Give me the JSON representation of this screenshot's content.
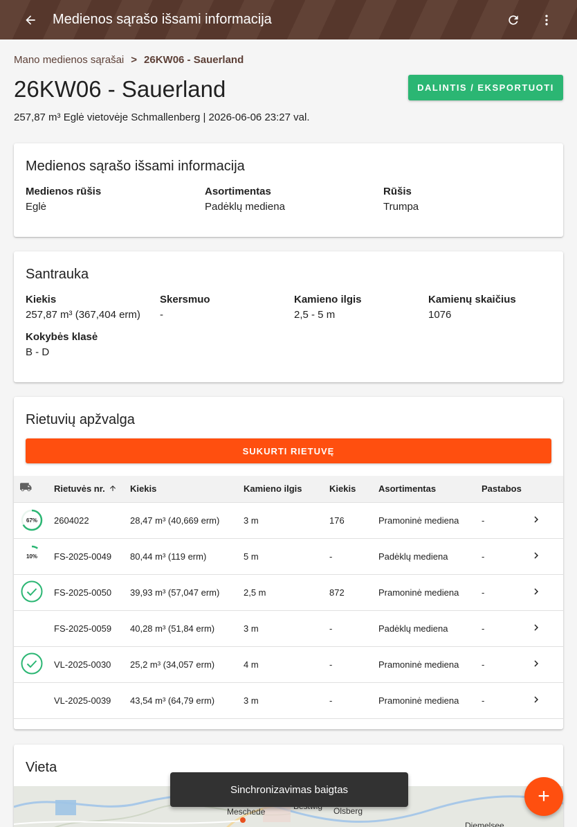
{
  "appbar": {
    "title": "Medienos sąrašo išsami informacija",
    "back_icon": "arrow-left-icon",
    "refresh_icon": "refresh-icon",
    "more_icon": "more-vert-icon",
    "color": "#5b3a2e"
  },
  "breadcrumb": {
    "parent": "Mano medienos sąrašai",
    "separator": ">",
    "current": "26KW06 - Sauerland"
  },
  "page": {
    "title": "26KW06 - Sauerland",
    "subtitle": "257,87 m³ Eglė vietovėje Schmallenberg | 2026-06-06 23:27 val.",
    "share_label": "DALINTIS / EKSPORTUOTI",
    "accent_green": "#2bb673",
    "accent_orange": "#ff4f0f"
  },
  "details": {
    "heading": "Medienos sąrašo išsami informacija",
    "fields": [
      {
        "label": "Medienos rūšis",
        "value": "Eglė"
      },
      {
        "label": "Asortimentas",
        "value": "Padėklų mediena"
      },
      {
        "label": "Rūšis",
        "value": "Trumpa"
      }
    ]
  },
  "summary": {
    "heading": "Santrauka",
    "fields": [
      {
        "label": "Kiekis",
        "value": "257,87 m³ (367,404 erm)"
      },
      {
        "label": "Skersmuo",
        "value": "-"
      },
      {
        "label": "Kamieno ilgis",
        "value": "2,5 - 5 m"
      },
      {
        "label": "Kamienų skaičius",
        "value": "1076"
      },
      {
        "label": "Kokybės klasė",
        "value": "B - D"
      }
    ]
  },
  "piles": {
    "heading": "Rietuvių apžvalga",
    "create_label": "SUKURTI RIETUVĘ",
    "columns": [
      "",
      "Rietuvės nr.",
      "Kiekis",
      "Kamieno ilgis",
      "Kiekis",
      "Asortimentas",
      "Pastabos",
      ""
    ],
    "truck_icon": "truck-icon",
    "sort_icon": "arrow-up-icon",
    "rows": [
      {
        "status": "progress",
        "progress_label": "67%",
        "progress": 0.67,
        "id": "2604022",
        "volume": "28,47 m³ (40,669 erm)",
        "length": "3 m",
        "count": "176",
        "assortment": "Pramoninė mediena",
        "notes": "-"
      },
      {
        "status": "progress",
        "progress_label": "10%",
        "progress": 0.1,
        "id": "FS-2025-0049",
        "volume": "80,44 m³ (119 erm)",
        "length": "5 m",
        "count": "-",
        "assortment": "Padėklų mediena",
        "notes": "-"
      },
      {
        "status": "done",
        "id": "FS-2025-0050",
        "volume": "39,93 m³ (57,047 erm)",
        "length": "2,5 m",
        "count": "872",
        "assortment": "Pramoninė mediena",
        "notes": "-"
      },
      {
        "status": "none",
        "id": "FS-2025-0059",
        "volume": "40,28 m³ (51,84 erm)",
        "length": "3 m",
        "count": "-",
        "assortment": "Padėklų mediena",
        "notes": "-"
      },
      {
        "status": "done",
        "id": "VL-2025-0030",
        "volume": "25,2 m³ (34,057 erm)",
        "length": "4 m",
        "count": "-",
        "assortment": "Pramoninė mediena",
        "notes": "-"
      },
      {
        "status": "none",
        "id": "VL-2025-0039",
        "volume": "43,54 m³ (64,79 erm)",
        "length": "3 m",
        "count": "-",
        "assortment": "Pramoninė mediena",
        "notes": "-"
      }
    ]
  },
  "location": {
    "heading": "Vieta",
    "map_labels": [
      "Meschede",
      "Bestwig",
      "Olsberg",
      "Diemelsee"
    ]
  },
  "toast": {
    "message": "Sinchronizavimas baigtas"
  },
  "fab": {
    "icon": "plus-icon",
    "label": "+"
  }
}
